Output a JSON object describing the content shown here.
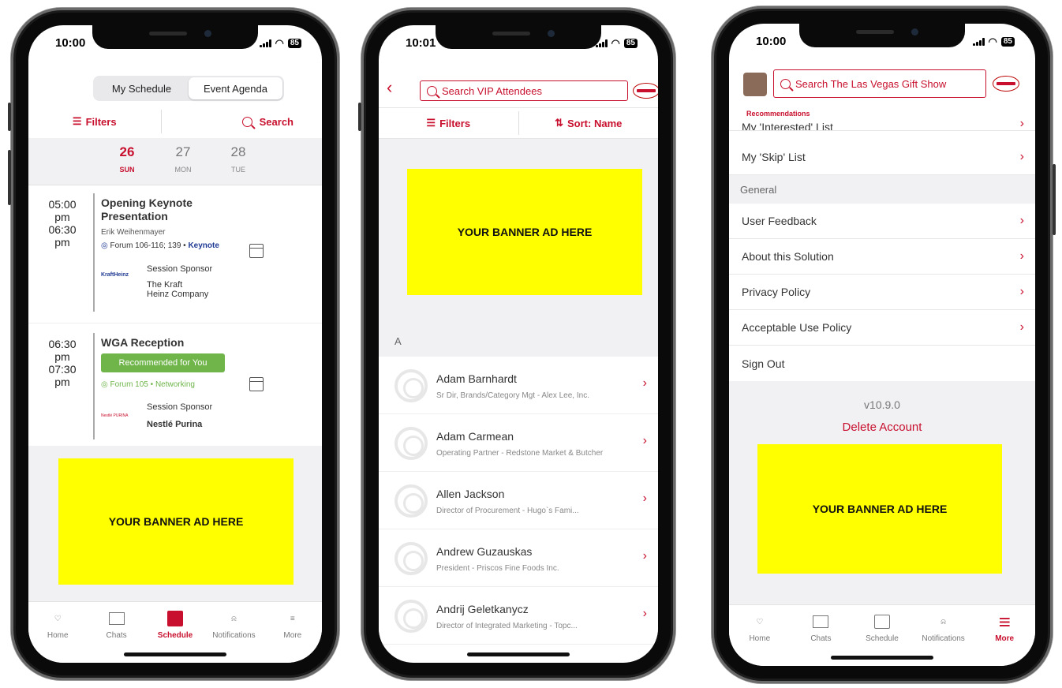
{
  "phone1": {
    "status": {
      "time": "10:00",
      "battery": "85"
    },
    "segment": {
      "left": "My Schedule",
      "right": "Event Agenda"
    },
    "filters_label": "Filters",
    "search_label": "Search",
    "dates": [
      {
        "num": "26",
        "day": "SUN",
        "selected": true
      },
      {
        "num": "27",
        "day": "MON",
        "selected": false
      },
      {
        "num": "28",
        "day": "TUE",
        "selected": false
      }
    ],
    "sessions": [
      {
        "time_start": "05:00",
        "start_ampm": "pm",
        "time_end": "06:30",
        "end_ampm": "pm",
        "title_line1": "Opening Keynote",
        "title_line2": "Presentation",
        "speaker": "Erik Weihenmayer",
        "location": "Forum 106-116; 139",
        "track": "Keynote",
        "sponsor_label": "Session Sponsor",
        "sponsor_line1": "The Kraft",
        "sponsor_line2": "Heinz Company",
        "sponsor_logo_text": "KraftHeinz"
      },
      {
        "time_start": "06:30",
        "start_ampm": "pm",
        "time_end": "07:30",
        "end_ampm": "pm",
        "title_line1": "WGA Reception",
        "badge": "Recommended for You",
        "location": "Forum 105",
        "track": "Networking",
        "sponsor_label": "Session Sponsor",
        "sponsor_line1": "Nestlé Purina",
        "sponsor_logo_text": "Nestlé PURINA"
      }
    ],
    "banner": "YOUR BANNER AD HERE",
    "tabs": [
      {
        "label": "Home",
        "icon": "handshake-icon"
      },
      {
        "label": "Chats",
        "icon": "chat-icon"
      },
      {
        "label": "Schedule",
        "icon": "calendar-icon",
        "active": true
      },
      {
        "label": "Notifications",
        "icon": "bell-icon"
      },
      {
        "label": "More",
        "icon": "menu-icon"
      }
    ]
  },
  "phone2": {
    "status": {
      "time": "10:01",
      "battery": "85"
    },
    "search_placeholder": "Search VIP Attendees",
    "filters_label": "Filters",
    "sort_label": "Sort: Name",
    "banner": "YOUR BANNER AD HERE",
    "section": "A",
    "attendees": [
      {
        "name": "Adam Barnhardt",
        "title": "Sr Dir, Brands/Category Mgt - Alex Lee, Inc."
      },
      {
        "name": "Adam Carmean",
        "title": "Operating Partner - Redstone Market & Butcher"
      },
      {
        "name": "Allen Jackson",
        "title": "Director of Procurement  - Hugo`s Fami..."
      },
      {
        "name": "Andrew Guzauskas",
        "title": "President - Priscos Fine Foods Inc."
      },
      {
        "name": "Andrij Geletkanycz",
        "title": "Director of Integrated Marketing - Topc..."
      }
    ]
  },
  "phone3": {
    "status": {
      "time": "10:00",
      "battery": "85"
    },
    "search_placeholder": "Search The Las Vegas Gift Show",
    "recommendations_label": "Recommendations",
    "cut_item": "My 'Interested' List",
    "skip_item": "My 'Skip' List",
    "general_header": "General",
    "menu": [
      "User Feedback",
      "About this Solution",
      "Privacy Policy",
      "Acceptable Use Policy"
    ],
    "sign_out": "Sign Out",
    "version": "v10.9.0",
    "delete_account": "Delete Account",
    "banner": "YOUR BANNER AD HERE",
    "tabs": [
      {
        "label": "Home",
        "icon": "handshake-icon"
      },
      {
        "label": "Chats",
        "icon": "chat-icon"
      },
      {
        "label": "Schedule",
        "icon": "calendar-icon"
      },
      {
        "label": "Notifications",
        "icon": "bell-icon"
      },
      {
        "label": "More",
        "icon": "menu-icon",
        "active": true
      }
    ]
  },
  "colors": {
    "accent": "#c8102e",
    "banner": "#ffff00",
    "recommended": "#6fb54a",
    "keynote_track": "#1f3a93",
    "networking_track": "#6fb54a"
  }
}
